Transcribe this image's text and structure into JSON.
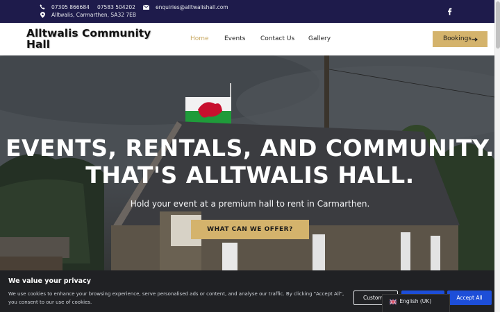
{
  "topbar": {
    "phone1": "07305 866684",
    "phone2": "07583 504202",
    "email": "enquiries@alltwalishall.com",
    "address": "Alltwalis, Carmarthen, SA32 7EB",
    "social_icon": "facebook-icon"
  },
  "nav": {
    "logo": "Alltwalis Community Hall",
    "items": [
      {
        "label": "Home",
        "active": true
      },
      {
        "label": "Events"
      },
      {
        "label": "Contact Us"
      },
      {
        "label": "Gallery"
      }
    ],
    "cta": "Bookings"
  },
  "hero": {
    "title_line1": "EVENTS, RENTALS, AND COMMUNITY.",
    "title_line2": "THAT'S ALLTWALIS HALL.",
    "subtitle": "Hold your event at a premium hall to rent in Carmarthen.",
    "button": "WHAT CAN WE OFFER?"
  },
  "cookie": {
    "title": "We value your privacy",
    "description": "We use cookies to enhance your browsing experience, serve personalised ads or content, and analyse our traffic. By clicking \"Accept All\", you consent to our use of cookies.",
    "customize": "Custom",
    "accept": "Accept All"
  },
  "language": {
    "label": "English (UK)"
  },
  "colors": {
    "topbar": "#1e1b4b",
    "accent": "#d4b36c",
    "active_nav": "#c9a962",
    "cookie_bg": "#202124",
    "cookie_button": "#1d4ed8"
  }
}
